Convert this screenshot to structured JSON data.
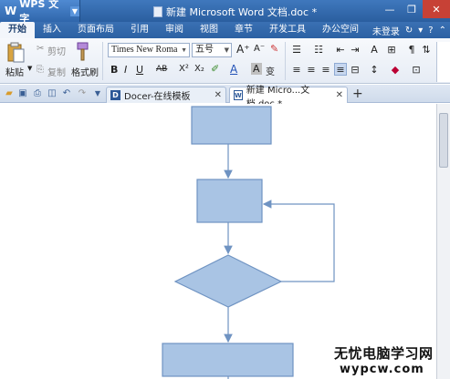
{
  "app": {
    "logo": "W",
    "name": "WPS 文字",
    "window_title": "新建 Microsoft Word 文档.doc *"
  },
  "window_controls": {
    "minimize": "—",
    "maximize": "❐",
    "close": "✕"
  },
  "menu": {
    "tabs": [
      "开始",
      "插入",
      "页面布局",
      "引用",
      "审阅",
      "视图",
      "章节",
      "开发工具",
      "办公空间"
    ],
    "active_tab": "开始",
    "login": "未登录"
  },
  "ribbon": {
    "paste": "粘贴",
    "cut": "剪切",
    "copy": "复制",
    "format_painter": "格式刷",
    "font_name": "Times New Roma",
    "font_size": "五号",
    "bold": "B",
    "italic": "I",
    "underline": "U",
    "strike": "AB",
    "superscript": "X²",
    "subscript": "X₂",
    "font_color": "A",
    "char_shade": "A",
    "phonetic": "变",
    "grow": "A⁺",
    "shrink": "A⁻"
  },
  "doc_tabs": [
    {
      "label": "Docer-在线模板",
      "active": false
    },
    {
      "label": "新建 Micro...文档.doc *",
      "active": true
    }
  ],
  "add_tab": "+",
  "watermark": {
    "line1": "无忧电脑学习网",
    "line2": "wypcw.com"
  },
  "colors": {
    "shape_fill": "#a9c4e4",
    "shape_stroke": "#6f93c2",
    "connector": "#6f93c2",
    "title_bar": "#2f66ab",
    "close": "#c74136"
  }
}
